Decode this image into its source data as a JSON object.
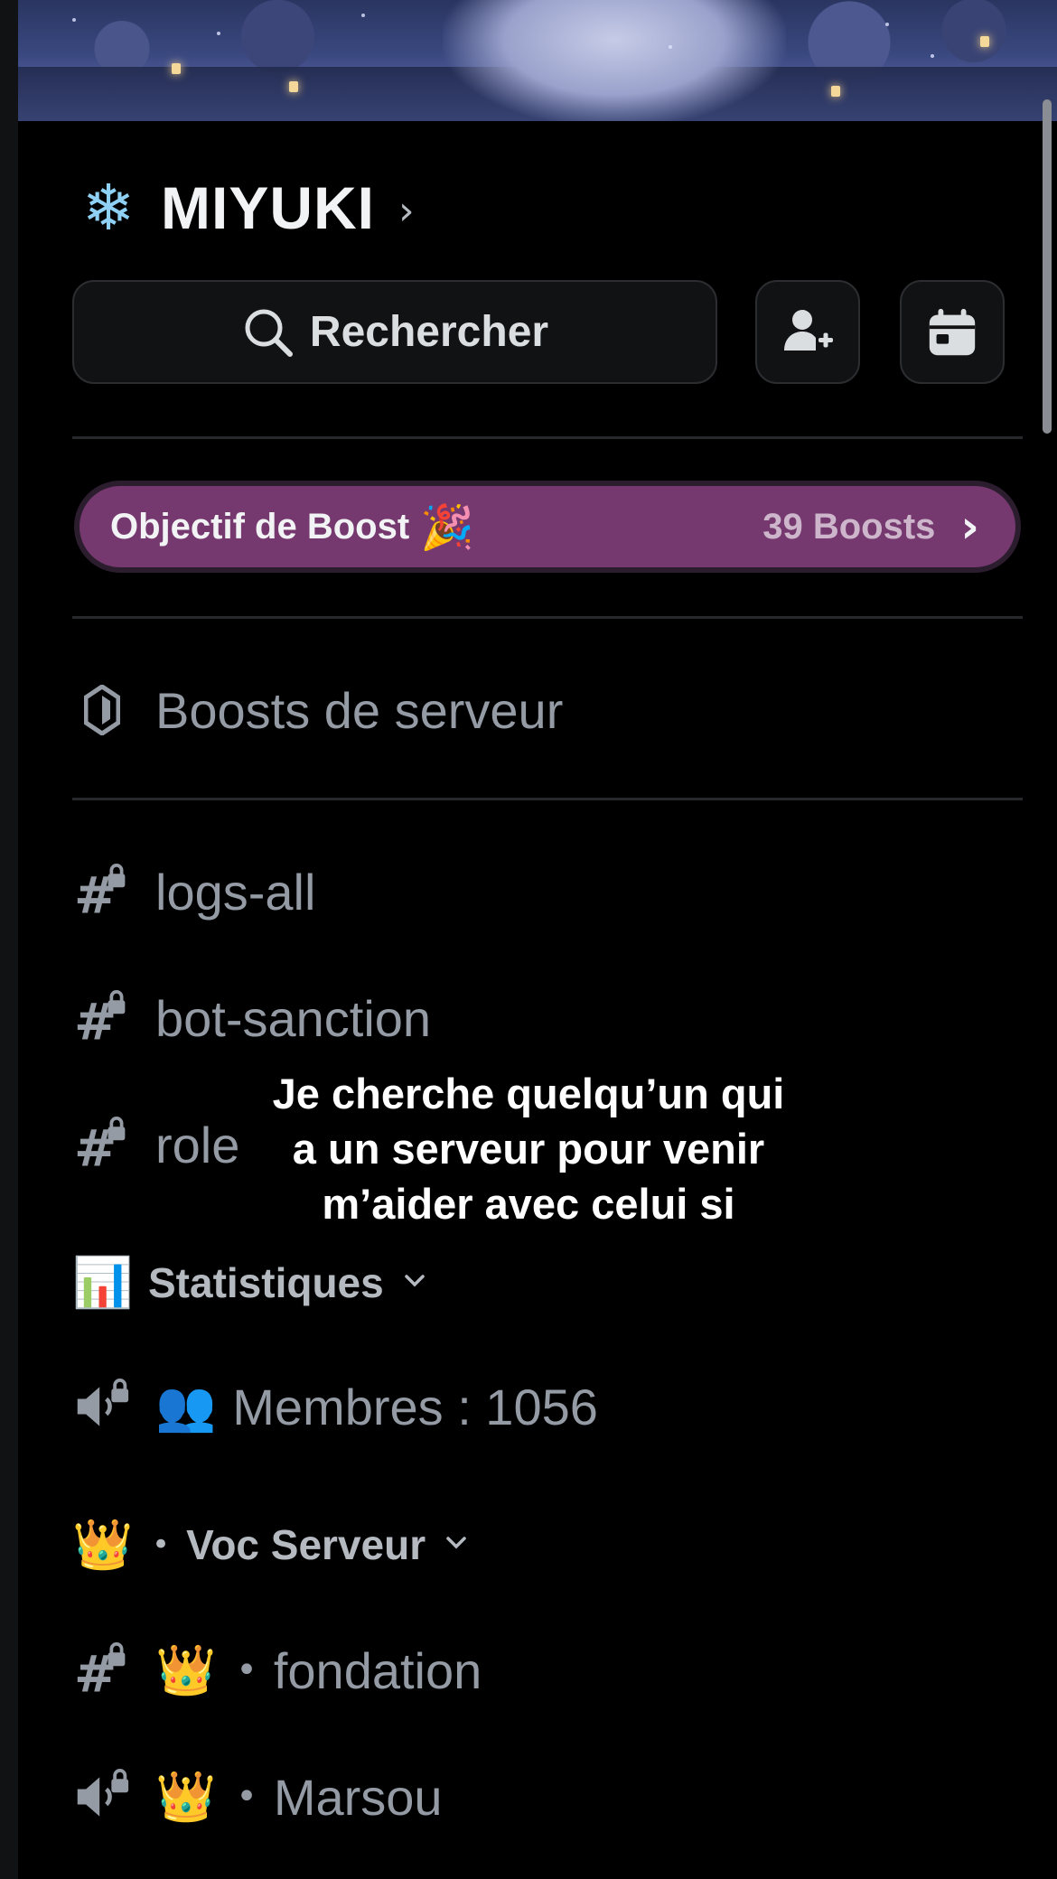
{
  "server": {
    "name": "MIYUKI",
    "icon": "snowflake-icon"
  },
  "header": {
    "search_label": "Rechercher",
    "invite_icon": "add-member-icon",
    "events_icon": "calendar-icon"
  },
  "boost_goal": {
    "title": "Objectif de Boost",
    "emoji": "🎉",
    "count_label": "39 Boosts",
    "color": "#76396f"
  },
  "server_boosts": {
    "label": "Boosts de serveur"
  },
  "channels": [
    {
      "type": "text-locked",
      "name": "logs-all"
    },
    {
      "type": "text-locked",
      "name": "bot-sanction"
    },
    {
      "type": "text-locked",
      "name": "role"
    }
  ],
  "category_stats": {
    "emoji": "📊",
    "label": "Statistiques"
  },
  "stats_channel": {
    "type": "voice-locked",
    "emoji": "👥",
    "name": "Membres : 1056"
  },
  "category_voc": {
    "emoji": "👑",
    "separator": "•",
    "label": "Voc Serveur"
  },
  "voc_channels": [
    {
      "type": "text-locked",
      "emoji": "👑",
      "separator": "•",
      "name": "fondation"
    },
    {
      "type": "voice-locked",
      "emoji": "👑",
      "separator": "•",
      "name": "Marsou"
    }
  ],
  "overlay_caption": {
    "line1": "Je cherche quelqu’un qui",
    "line2": "a un serveur pour venir",
    "line3": "m’aider avec celui si"
  }
}
